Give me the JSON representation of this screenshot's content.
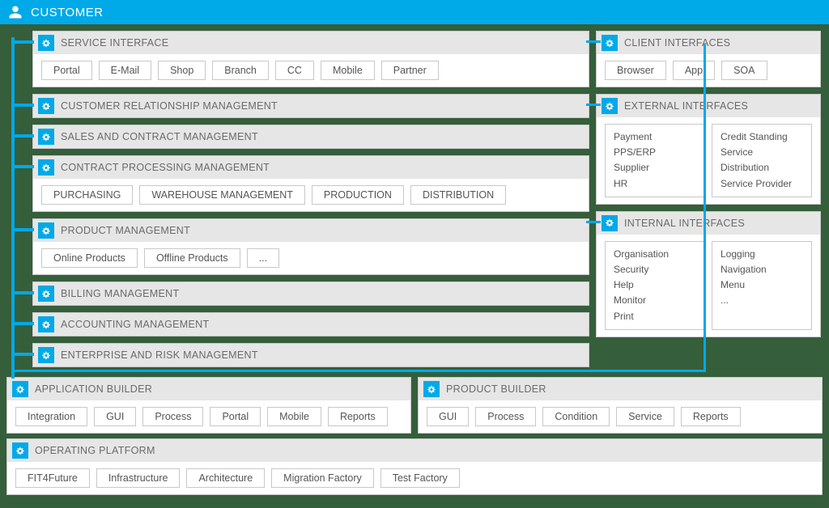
{
  "header": {
    "title": "CUSTOMER"
  },
  "left_panels": [
    {
      "title": "SERVICE INTERFACE",
      "items": [
        "Portal",
        "E-Mail",
        "Shop",
        "Branch",
        "CC",
        "Mobile",
        "Partner"
      ]
    },
    {
      "title": "CUSTOMER RELATIONSHIP MANAGEMENT",
      "items": []
    },
    {
      "title": "SALES AND CONTRACT MANAGEMENT",
      "items": []
    },
    {
      "title": "CONTRACT PROCESSING MANAGEMENT",
      "items": [
        "PURCHASING",
        "WAREHOUSE MANAGEMENT",
        "PRODUCTION",
        "DISTRIBUTION"
      ]
    },
    {
      "title": "PRODUCT MANAGEMENT",
      "items": [
        "Online Products",
        "Offline Products",
        "..."
      ]
    },
    {
      "title": "BILLING MANAGEMENT",
      "items": []
    },
    {
      "title": "ACCOUNTING MANAGEMENT",
      "items": []
    },
    {
      "title": "ENTERPRISE AND RISK MANAGEMENT",
      "items": []
    }
  ],
  "right_panels": [
    {
      "title": "CLIENT INTERFACES",
      "chips": [
        "Browser",
        "App",
        "SOA"
      ]
    },
    {
      "title": "EXTERNAL INTERFACES",
      "cols": [
        [
          "Payment",
          "PPS/ERP",
          "Supplier",
          "HR"
        ],
        [
          "Credit Standing",
          "Service",
          "Distribution",
          "Service Provider"
        ]
      ]
    },
    {
      "title": "INTERNAL INTERFACES",
      "cols": [
        [
          "Organisation",
          "Security",
          "Help",
          "Monitor",
          "Print"
        ],
        [
          "Logging",
          "Navigation",
          "Menu",
          "..."
        ]
      ]
    }
  ],
  "bottom": {
    "app_builder": {
      "title": "APPLICATION BUILDER",
      "items": [
        "Integration",
        "GUI",
        "Process",
        "Portal",
        "Mobile",
        "Reports"
      ]
    },
    "prod_builder": {
      "title": "PRODUCT BUILDER",
      "items": [
        "GUI",
        "Process",
        "Condition",
        "Service",
        "Reports"
      ]
    },
    "platform": {
      "title": "OPERATING PLATFORM",
      "items": [
        "FIT4Future",
        "Infrastructure",
        "Architecture",
        "Migration Factory",
        "Test Factory"
      ]
    }
  },
  "colors": {
    "accent": "#00a9e8"
  }
}
